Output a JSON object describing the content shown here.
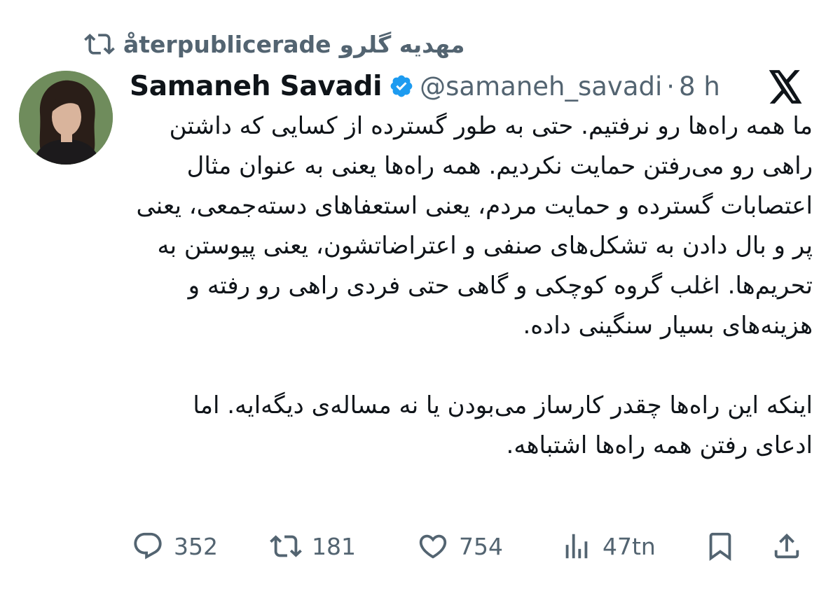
{
  "repost": {
    "icon": "repost-icon",
    "user": "مهدیه گلرو",
    "label": "återpublicerade"
  },
  "tweet": {
    "author": {
      "name": "Samaneh Savadi",
      "verified": true,
      "handle": "@samaneh_savadi",
      "separator": "·",
      "time": "8 h"
    },
    "paragraphs": [
      "ما همه راه‌ها رو نرفتیم. حتی به طور گسترده از کسایی که داشتن راهی رو می‌رفتن حمایت نکردیم. همه راه‌ها یعنی به عنوان مثال اعتصابات گسترده و حمایت مردم، یعنی استعفاهای دسته‌جمعی، یعنی پر و بال دادن به تشکل‌های صنفی و اعتراضاتشون، یعنی پیوستن به تحریم‌ها. اغلب گروه کوچکی و گاهی حتی فردی راهی رو رفته و هزینه‌های بسیار سنگینی داده.",
      "اینکه این راه‌ها چقدر کارساز می‌بودن یا نه مساله‌ی دیگه‌ایه. اما ادعای رفتن همه راه‌ها اشتباهه."
    ],
    "actions": {
      "replies": "352",
      "reposts": "181",
      "likes": "754",
      "views": "47tn"
    }
  },
  "colors": {
    "text": "#0f1419",
    "muted": "#536471",
    "verified_blue": "#1d9bf0"
  }
}
